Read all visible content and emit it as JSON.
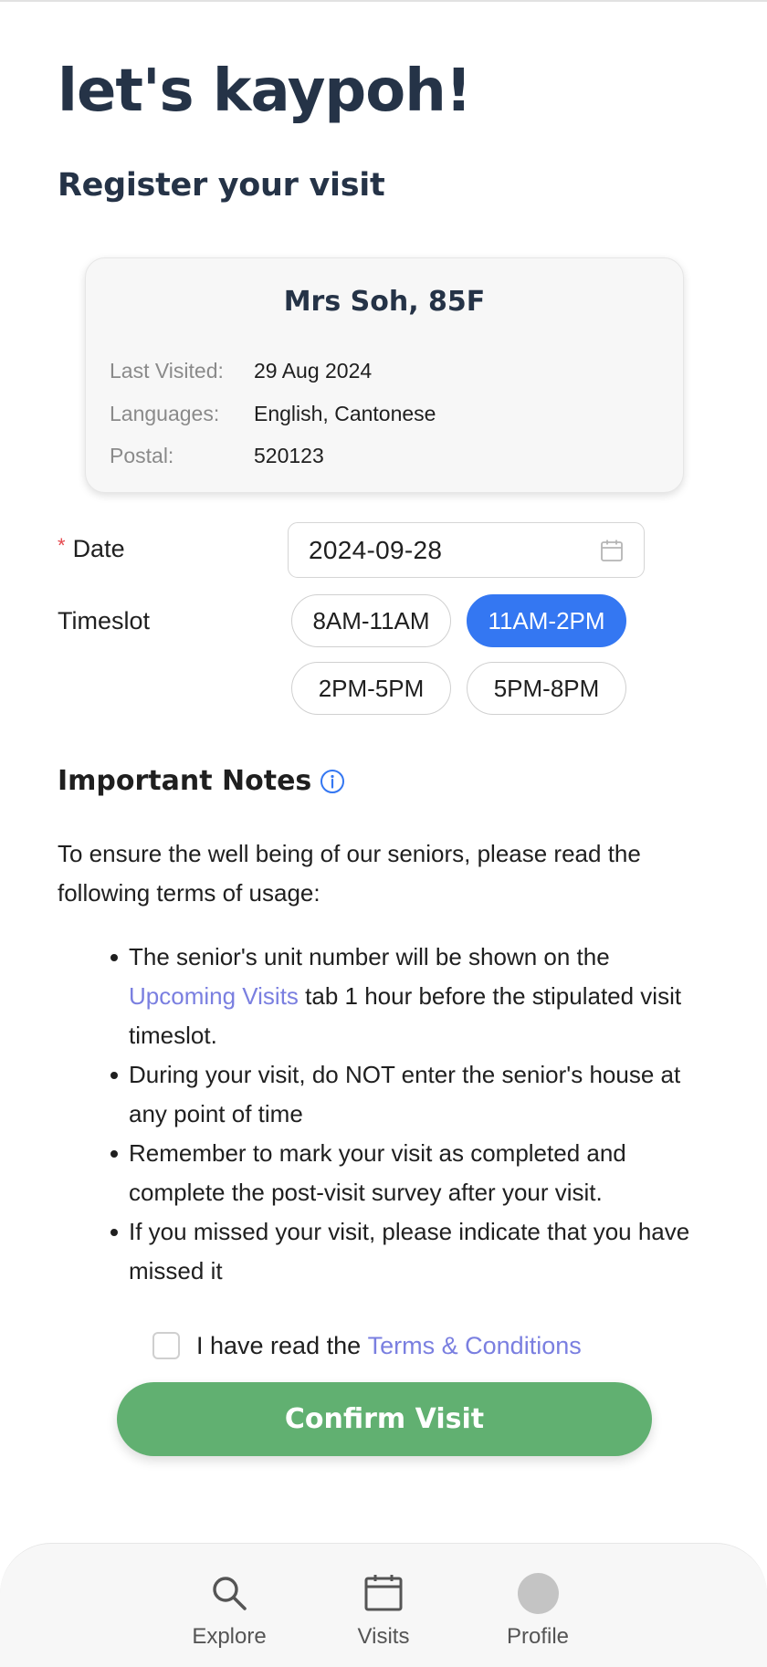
{
  "app": {
    "title": "let's kaypoh!"
  },
  "page": {
    "subtitle": "Register your visit"
  },
  "senior": {
    "name": "Mrs Soh, 85F",
    "rows": [
      {
        "label": "Last Visited:",
        "value": "29 Aug 2024"
      },
      {
        "label": "Languages:",
        "value": "English, Cantonese"
      },
      {
        "label": "Postal:",
        "value": "520123"
      }
    ]
  },
  "form": {
    "date_required_mark": "*",
    "date_label": "Date",
    "date_value": "2024-09-28",
    "timeslot_label": "Timeslot",
    "timeslots": [
      {
        "label": "8AM-11AM",
        "selected": false
      },
      {
        "label": "11AM-2PM",
        "selected": true
      },
      {
        "label": "2PM-5PM",
        "selected": false
      },
      {
        "label": "5PM-8PM",
        "selected": false
      }
    ]
  },
  "notes": {
    "heading": "Important Notes",
    "intro": "To ensure the well being of our seniors, please read the following terms of usage:",
    "item1_pre": "The senior's unit number will be shown on the ",
    "item1_link": "Upcoming Visits",
    "item1_post": " tab 1 hour before the stipulated visit timeslot.",
    "item2": "During your visit, do NOT enter the senior's house at any point of time",
    "item3": "Remember to mark your visit as completed and complete the post-visit survey after your visit.",
    "item4": "If you missed your visit, please indicate that you have missed it"
  },
  "agree": {
    "checked": false,
    "text": "I have read the ",
    "link": "Terms & Conditions"
  },
  "confirm_label": "Confirm Visit",
  "nav": [
    {
      "label": "Explore",
      "icon": "search-icon"
    },
    {
      "label": "Visits",
      "icon": "calendar-icon"
    },
    {
      "label": "Profile",
      "icon": "avatar"
    }
  ],
  "colors": {
    "primary_blue": "#3477f2",
    "confirm_green": "#61b071",
    "link_purple": "#7a7fe0",
    "heading_navy": "#253347",
    "required_red": "#e5484d"
  }
}
